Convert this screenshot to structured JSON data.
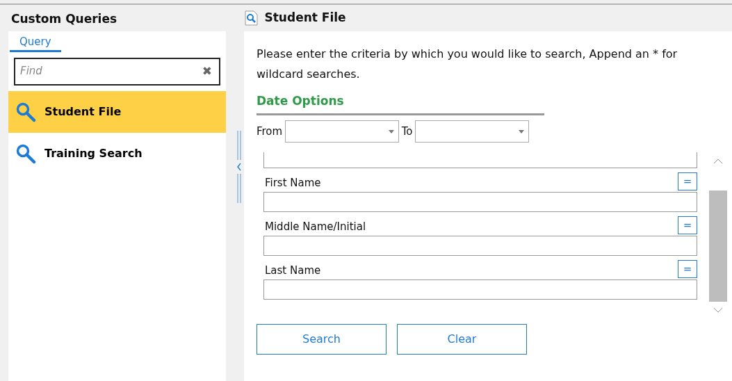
{
  "sidebar": {
    "title": "Custom Queries",
    "tabs": [
      {
        "label": "Query",
        "selected": true
      }
    ],
    "search": {
      "placeholder": "Find",
      "clear": "✖"
    },
    "items": [
      {
        "label": "Student File",
        "selected": true
      },
      {
        "label": "Training Search",
        "selected": false
      }
    ]
  },
  "main": {
    "title": "Student File",
    "instructions": "Please enter the criteria by which you would like to search, Append an * for wildcard searches.",
    "date_options": {
      "title": "Date Options",
      "from_label": "From",
      "to_label": "To"
    },
    "fields": [
      {
        "label": "First Name",
        "operator": "="
      },
      {
        "label": "Middle Name/Initial",
        "operator": "="
      },
      {
        "label": "Last Name",
        "operator": "="
      }
    ],
    "buttons": [
      "Search",
      "Clear"
    ]
  }
}
